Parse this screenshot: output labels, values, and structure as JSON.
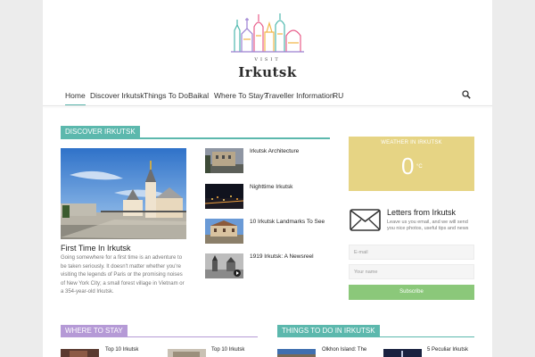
{
  "logo": {
    "visit": "VISIT",
    "name": "Irkutsk"
  },
  "nav": {
    "items": [
      {
        "label": "Home",
        "active": true
      },
      {
        "label": "Discover Irkutsk"
      },
      {
        "label": "Things To Do"
      },
      {
        "label": "Baikal"
      },
      {
        "label": "Where To Stay?"
      },
      {
        "label": "Traveller Information"
      },
      {
        "label": "RU"
      }
    ],
    "search_icon": "search-icon"
  },
  "discover": {
    "heading": "DISCOVER IRKUTSK",
    "color": "#5cb8ad",
    "hero": {
      "title": "First Time In Irkutsk",
      "excerpt": "Going somewhere for a first time is an adventure to be taken seriously. It doesn't matter whether you're visiting the legends of Paris or the promising noises of New York City; a small forest village in Vietnam or a 354-year-old Irkutsk."
    },
    "items": [
      {
        "title": "Irkutsk Architecture"
      },
      {
        "title": "Nighttime Irkutsk"
      },
      {
        "title": "10 Irkutsk Landmarks To See"
      },
      {
        "title": "1919 Irkutsk: A Newsreel"
      }
    ]
  },
  "weather": {
    "label": "WEATHER IN IRKUTSK",
    "temp": "0",
    "unit": "°C",
    "color": "#e6d484"
  },
  "newsletter": {
    "icon": "envelope-icon",
    "title": "Letters from Irkutsk",
    "text": "Leave us you email, and we will send you nice photos, useful tips and news",
    "email_placeholder": "E-mail",
    "name_placeholder": "Your name",
    "subscribe_label": "Subscribe",
    "button_color": "#8bc87a"
  },
  "where_to_stay": {
    "heading": "WHERE TO STAY",
    "color": "#b59ad6",
    "items": [
      {
        "title": "Top 10 Irkutsk"
      },
      {
        "title": "Top 10 Irkutsk"
      }
    ]
  },
  "things_to_do": {
    "heading": "THINGS TO DO IN IRKUTSK",
    "color": "#5cb8ad",
    "items": [
      {
        "title": "Olkhon Island: The"
      },
      {
        "title": "5 Peculiar Irkutsk"
      }
    ]
  }
}
